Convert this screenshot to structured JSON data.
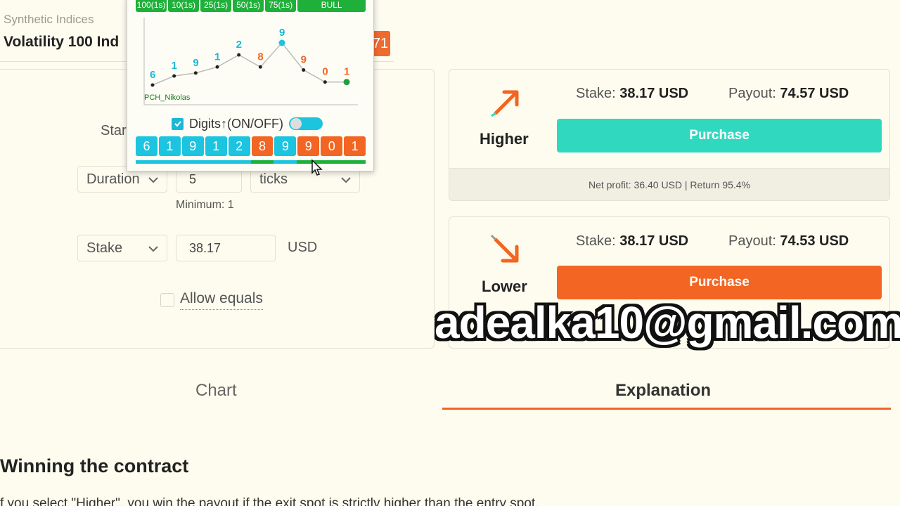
{
  "market": {
    "category": "Synthetic Indices",
    "name": "Volatility 100 Ind",
    "badge": "71"
  },
  "form": {
    "start_label": "Star",
    "duration": {
      "label": "Duration",
      "value": "5",
      "unit": "ticks",
      "minimum": "Minimum: 1"
    },
    "stake": {
      "label": "Stake",
      "value": "38.17",
      "currency": "USD"
    },
    "allow_equals_label": "Allow equals"
  },
  "higher": {
    "label": "Higher",
    "stake_label": "Stake:",
    "stake_value": "38.17 USD",
    "payout_label": "Payout:",
    "payout_value": "74.57 USD",
    "button": "Purchase",
    "footer": "Net profit: 36.40 USD | Return 95.4%",
    "color": "#31d8c0"
  },
  "lower": {
    "label": "Lower",
    "stake_label": "Stake:",
    "stake_value": "38.17 USD",
    "payout_label": "Payout:",
    "payout_value": "74.53 USD",
    "button": "Purchase",
    "color": "#f26522"
  },
  "overlay_text": "adealka10@gmail.com",
  "tabs": {
    "chart": "Chart",
    "explanation": "Explanation"
  },
  "content": {
    "heading": "Winning the contract",
    "paragraph": "f you select \"Higher\", you win the payout if the exit spot is strictly higher than the entry spot."
  },
  "widget": {
    "timeframes": [
      "100(1s)",
      "10(1s)",
      "25(1s)",
      "50(1s)",
      "75(1s)",
      "BULL"
    ],
    "author": "PCH_Nikolas",
    "digits_label": "Digits↑(ON/OFF)",
    "digits": [
      {
        "d": "6",
        "c": "blue"
      },
      {
        "d": "1",
        "c": "blue"
      },
      {
        "d": "9",
        "c": "blue"
      },
      {
        "d": "1",
        "c": "blue"
      },
      {
        "d": "2",
        "c": "blue"
      },
      {
        "d": "8",
        "c": "orange"
      },
      {
        "d": "9",
        "c": "blue"
      },
      {
        "d": "9",
        "c": "orange"
      },
      {
        "d": "0",
        "c": "orange"
      },
      {
        "d": "1",
        "c": "orange"
      }
    ],
    "progress_colors": [
      "#1cc4e0",
      "#1cc4e0",
      "#1cc4e0",
      "#1cc4e0",
      "#1cc4e0",
      "#1fb03a",
      "#1cc4e0",
      "#1fb03a",
      "#1fb03a",
      "#1fb03a"
    ]
  },
  "chart_data": {
    "type": "line",
    "x": [
      1,
      2,
      3,
      4,
      5,
      6,
      7,
      8,
      9,
      10
    ],
    "values": [
      6,
      1,
      9,
      1,
      2,
      8,
      9,
      9,
      0,
      1
    ],
    "series_levels": [
      0,
      3,
      4,
      6,
      10,
      6,
      14,
      5,
      1,
      1
    ],
    "colors": [
      "blue",
      "blue",
      "blue",
      "blue",
      "blue",
      "orange",
      "blue",
      "orange",
      "orange",
      "orange"
    ]
  }
}
